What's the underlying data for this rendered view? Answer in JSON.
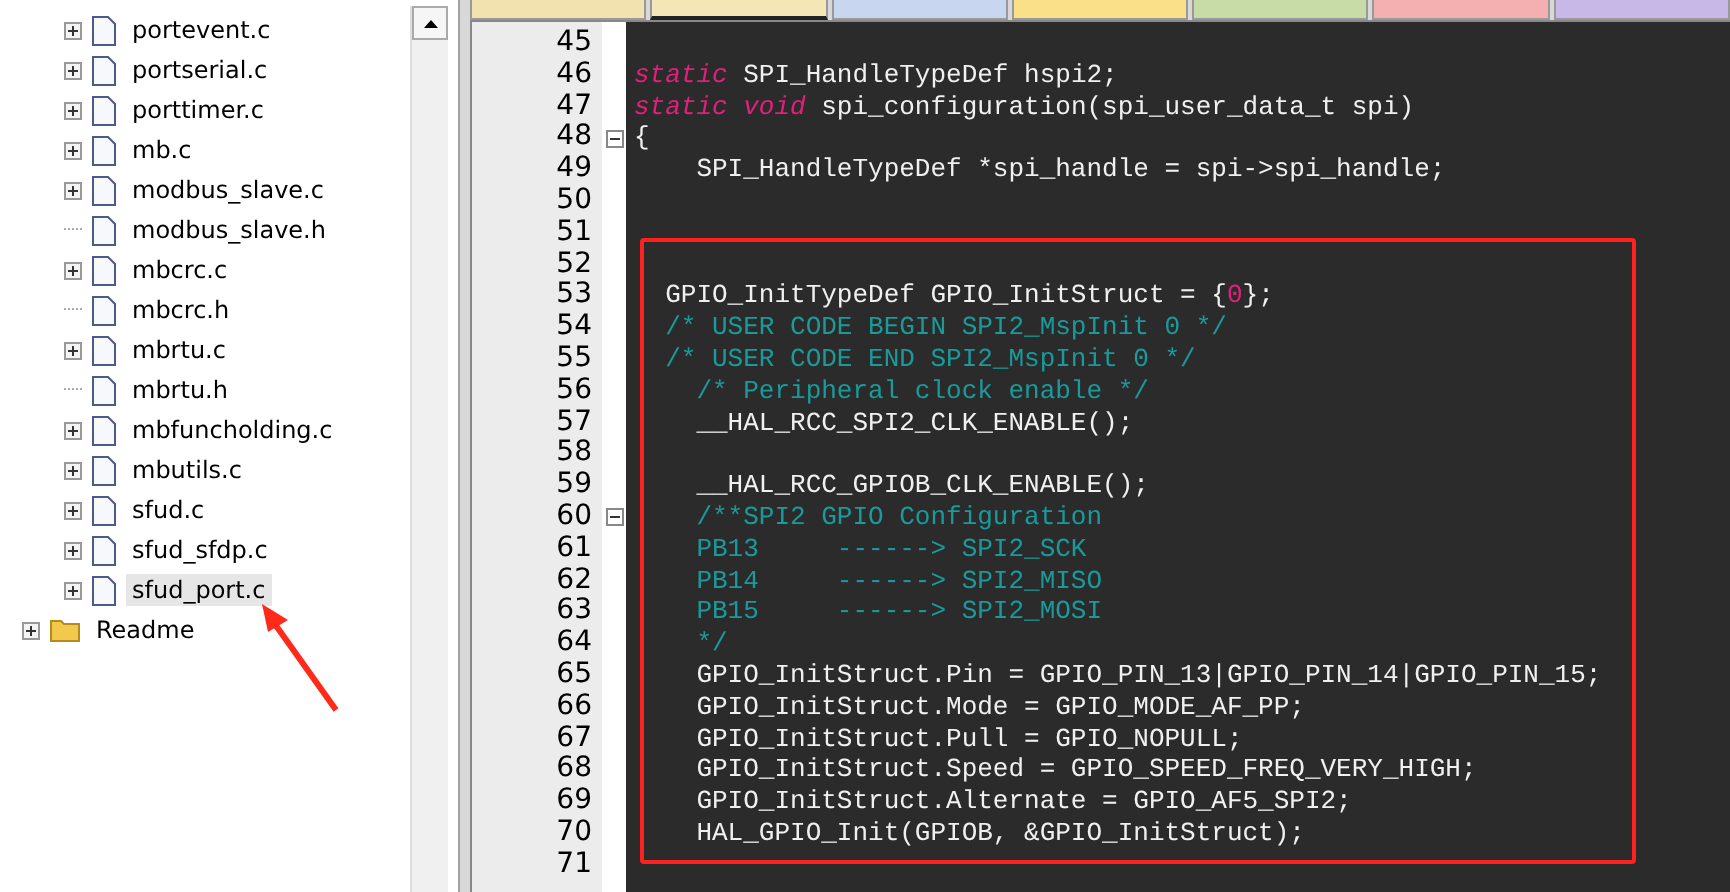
{
  "tree": {
    "files": [
      {
        "label": "portevent.c",
        "expandable": true,
        "selected": false
      },
      {
        "label": "portserial.c",
        "expandable": true,
        "selected": false
      },
      {
        "label": "porttimer.c",
        "expandable": true,
        "selected": false
      },
      {
        "label": "mb.c",
        "expandable": true,
        "selected": false
      },
      {
        "label": "modbus_slave.c",
        "expandable": true,
        "selected": false
      },
      {
        "label": "modbus_slave.h",
        "expandable": false,
        "selected": false
      },
      {
        "label": "mbcrc.c",
        "expandable": true,
        "selected": false
      },
      {
        "label": "mbcrc.h",
        "expandable": false,
        "selected": false
      },
      {
        "label": "mbrtu.c",
        "expandable": true,
        "selected": false
      },
      {
        "label": "mbrtu.h",
        "expandable": false,
        "selected": false
      },
      {
        "label": "mbfuncholding.c",
        "expandable": true,
        "selected": false
      },
      {
        "label": "mbutils.c",
        "expandable": true,
        "selected": false
      },
      {
        "label": "sfud.c",
        "expandable": true,
        "selected": false
      },
      {
        "label": "sfud_sfdp.c",
        "expandable": true,
        "selected": false
      },
      {
        "label": "sfud_port.c",
        "expandable": true,
        "selected": true
      }
    ],
    "folders": [
      {
        "label": "Readme",
        "expandable": true
      }
    ]
  },
  "tabs": [
    {
      "color": "#f2e2b0",
      "selected": false
    },
    {
      "color": "#f5e6b8",
      "selected": true
    },
    {
      "color": "#c9d6f0",
      "selected": false
    },
    {
      "color": "#fbe08a",
      "selected": false
    },
    {
      "color": "#c8dca8",
      "selected": false
    },
    {
      "color": "#f4b0b0",
      "selected": false
    },
    {
      "color": "#c8b8e8",
      "selected": false
    }
  ],
  "editor": {
    "lines": [
      {
        "number": "45",
        "fold": false
      },
      {
        "number": "46",
        "fold": false,
        "segments": [
          {
            "kind": "keyword",
            "text": "static"
          },
          {
            "kind": "plain",
            "text": " SPI_HandleTypeDef hspi2;"
          }
        ]
      },
      {
        "number": "47",
        "fold": false,
        "segments": [
          {
            "kind": "keyword",
            "text": "static void"
          },
          {
            "kind": "plain",
            "text": " spi_configuration(spi_user_data_t spi)"
          }
        ]
      },
      {
        "number": "48",
        "fold": true,
        "segments": [
          {
            "kind": "plain",
            "text": "{"
          }
        ]
      },
      {
        "number": "49",
        "fold": false,
        "segments": [
          {
            "kind": "plain",
            "text": "    SPI_HandleTypeDef *spi_handle = spi->spi_handle;"
          }
        ]
      },
      {
        "number": "50",
        "fold": false
      },
      {
        "number": "51",
        "fold": false
      },
      {
        "number": "52",
        "fold": false
      },
      {
        "number": "53",
        "fold": false,
        "segments": [
          {
            "kind": "plain",
            "text": "  GPIO_InitTypeDef GPIO_InitStruct = {"
          },
          {
            "kind": "number",
            "text": "0"
          },
          {
            "kind": "plain",
            "text": "};"
          }
        ]
      },
      {
        "number": "54",
        "fold": false,
        "segments": [
          {
            "kind": "comment",
            "text": "  /* USER CODE BEGIN SPI2_MspInit 0 */"
          }
        ]
      },
      {
        "number": "55",
        "fold": false,
        "segments": [
          {
            "kind": "comment",
            "text": "  /* USER CODE END SPI2_MspInit 0 */"
          }
        ]
      },
      {
        "number": "56",
        "fold": false,
        "segments": [
          {
            "kind": "comment",
            "text": "    /* Peripheral clock enable */"
          }
        ]
      },
      {
        "number": "57",
        "fold": false,
        "segments": [
          {
            "kind": "plain",
            "text": "    __HAL_RCC_SPI2_CLK_ENABLE();"
          }
        ]
      },
      {
        "number": "58",
        "fold": false
      },
      {
        "number": "59",
        "fold": false,
        "segments": [
          {
            "kind": "plain",
            "text": "    __HAL_RCC_GPIOB_CLK_ENABLE();"
          }
        ]
      },
      {
        "number": "60",
        "fold": true,
        "segments": [
          {
            "kind": "comment",
            "text": "    /**SPI2 GPIO Configuration"
          }
        ]
      },
      {
        "number": "61",
        "fold": false,
        "segments": [
          {
            "kind": "comment",
            "text": "    PB13     ------> SPI2_SCK"
          }
        ]
      },
      {
        "number": "62",
        "fold": false,
        "segments": [
          {
            "kind": "comment",
            "text": "    PB14     ------> SPI2_MISO"
          }
        ]
      },
      {
        "number": "63",
        "fold": false,
        "segments": [
          {
            "kind": "comment",
            "text": "    PB15     ------> SPI2_MOSI"
          }
        ]
      },
      {
        "number": "64",
        "fold": false,
        "segments": [
          {
            "kind": "comment",
            "text": "    */"
          }
        ]
      },
      {
        "number": "65",
        "fold": false,
        "segments": [
          {
            "kind": "plain",
            "text": "    GPIO_InitStruct.Pin = GPIO_PIN_13|GPIO_PIN_14|GPIO_PIN_15;"
          }
        ]
      },
      {
        "number": "66",
        "fold": false,
        "segments": [
          {
            "kind": "plain",
            "text": "    GPIO_InitStruct.Mode = GPIO_MODE_AF_PP;"
          }
        ]
      },
      {
        "number": "67",
        "fold": false,
        "segments": [
          {
            "kind": "plain",
            "text": "    GPIO_InitStruct.Pull = GPIO_NOPULL;"
          }
        ]
      },
      {
        "number": "68",
        "fold": false,
        "segments": [
          {
            "kind": "plain",
            "text": "    GPIO_InitStruct.Speed = GPIO_SPEED_FREQ_VERY_HIGH;"
          }
        ]
      },
      {
        "number": "69",
        "fold": false,
        "segments": [
          {
            "kind": "plain",
            "text": "    GPIO_InitStruct.Alternate = GPIO_AF5_SPI2;"
          }
        ]
      },
      {
        "number": "70",
        "fold": false,
        "segments": [
          {
            "kind": "plain",
            "text": "    HAL_GPIO_Init(GPIOB, &GPIO_InitStruct);"
          }
        ]
      },
      {
        "number": "71",
        "fold": false
      }
    ]
  }
}
